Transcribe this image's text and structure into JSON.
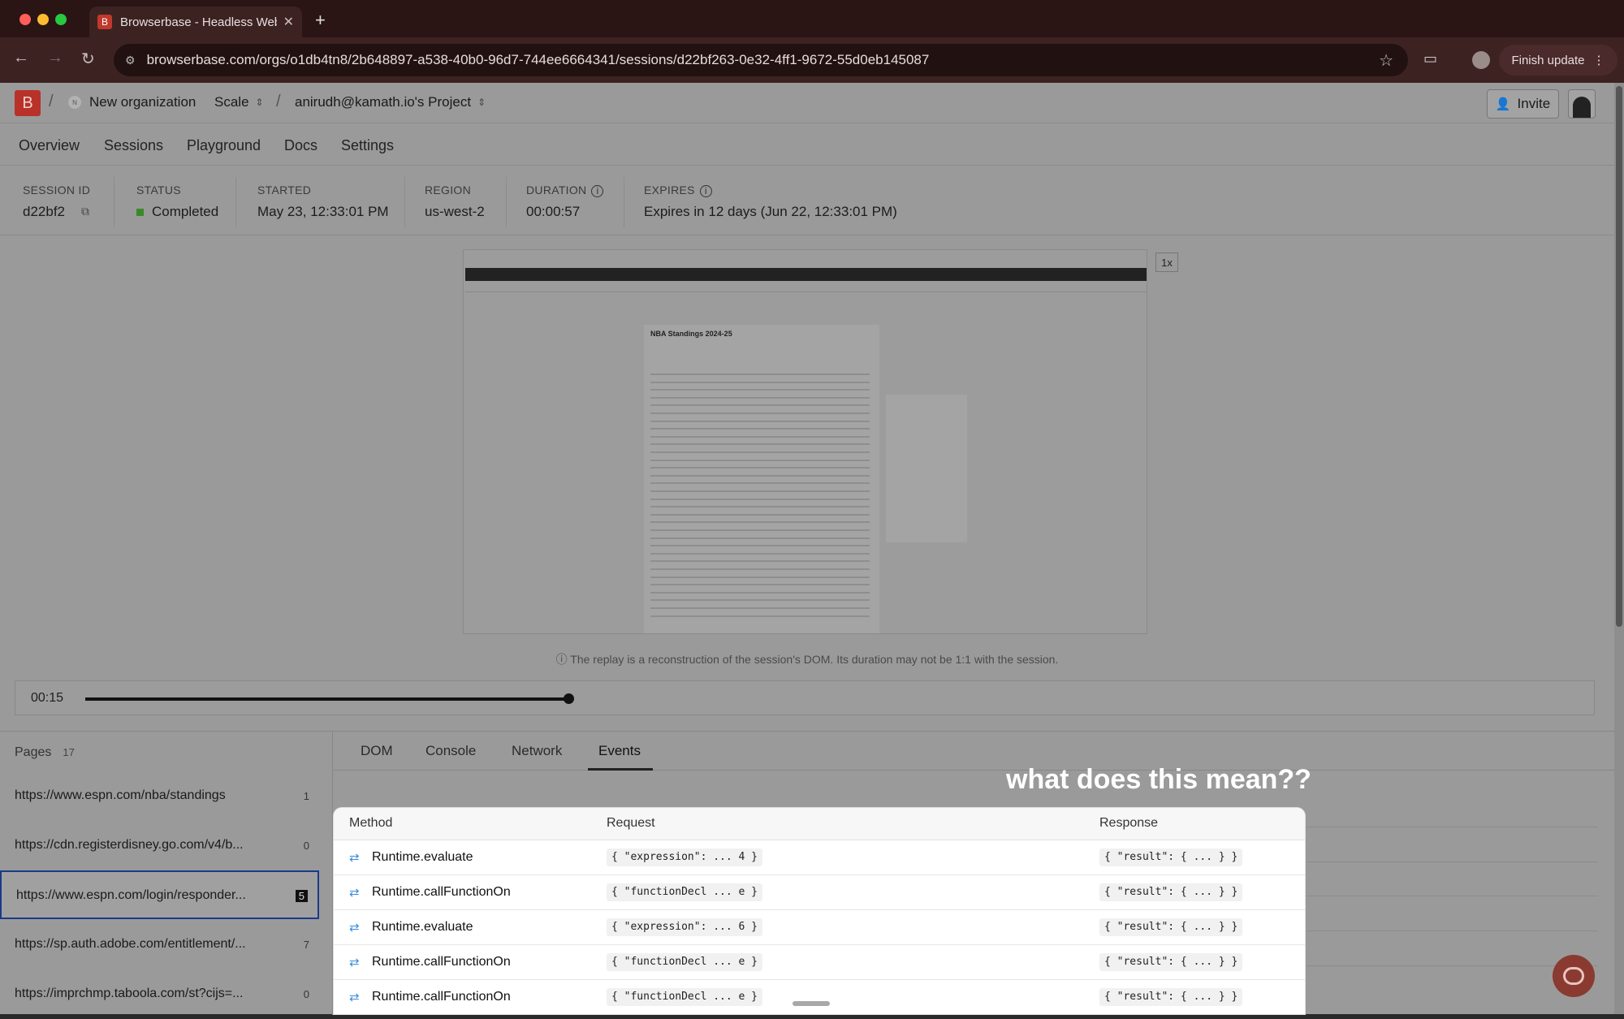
{
  "browser": {
    "tab_title": "Browserbase - Headless Web",
    "tab_favicon": "B",
    "url": "browserbase.com/orgs/o1db4tn8/2b648897-a538-40b0-96d7-744ee6664341/sessions/d22bf263-0e32-4ff1-9672-55d0eb145087",
    "finish_update": "Finish update",
    "new_tab": "+",
    "colors": {
      "tab_bar": "#2a1414",
      "toolbar": "#3d2222"
    }
  },
  "header": {
    "logo": "B",
    "org_badge": "N",
    "org_name": "New organization",
    "plan": "Scale",
    "project": "anirudh@kamath.io's Project",
    "invite_label": "Invite"
  },
  "nav": {
    "items": [
      "Overview",
      "Sessions",
      "Playground",
      "Docs",
      "Settings"
    ]
  },
  "session": {
    "id_label": "SESSION ID",
    "id_value": "d22bf2",
    "status_label": "STATUS",
    "status_value": "Completed",
    "started_label": "STARTED",
    "started_value": "May 23, 12:33:01 PM",
    "region_label": "REGION",
    "region_value": "us-west-2",
    "duration_label": "DURATION",
    "duration_value": "00:00:57",
    "expires_label": "EXPIRES",
    "expires_value": "Expires in 12 days (Jun 22, 12:33:01 PM)"
  },
  "replay": {
    "page_heading": "NBA Standings 2024-25",
    "speed": "1x",
    "note": "The replay is a reconstruction of the session's DOM. Its duration may not be 1:1 with the session.",
    "time": "00:15",
    "progress_fraction": 0.26
  },
  "pages": {
    "label": "Pages",
    "count": "17",
    "items": [
      {
        "url": "https://www.espn.com/nba/standings",
        "count": "1"
      },
      {
        "url": "https://cdn.registerdisney.go.com/v4/b...",
        "count": "0"
      },
      {
        "url": "https://www.espn.com/login/responder...",
        "count": "5"
      },
      {
        "url": "https://sp.auth.adobe.com/entitlement/...",
        "count": "7"
      },
      {
        "url": "https://imprchmp.taboola.com/st?cijs=...",
        "count": "0"
      }
    ]
  },
  "tabs": {
    "items": [
      "DOM",
      "Console",
      "Network",
      "Events"
    ],
    "selected": "Events"
  },
  "annotation": "what does this mean??",
  "events": {
    "columns": {
      "method": "Method",
      "request": "Request",
      "response": "Response"
    },
    "rows": [
      {
        "method": "Runtime.evaluate",
        "request": "{ \"expression\": ... 4 }",
        "response": "{ \"result\": { ... } }"
      },
      {
        "method": "Runtime.callFunctionOn",
        "request": "{ \"functionDecl ... e }",
        "response": "{ \"result\": { ... } }"
      },
      {
        "method": "Runtime.evaluate",
        "request": "{ \"expression\": ... 6 }",
        "response": "{ \"result\": { ... } }"
      },
      {
        "method": "Runtime.callFunctionOn",
        "request": "{ \"functionDecl ... e }",
        "response": "{ \"result\": { ... } }"
      },
      {
        "method": "Runtime.callFunctionOn",
        "request": "{ \"functionDecl ... e }",
        "response": "{ \"result\": { ... } }"
      }
    ]
  }
}
